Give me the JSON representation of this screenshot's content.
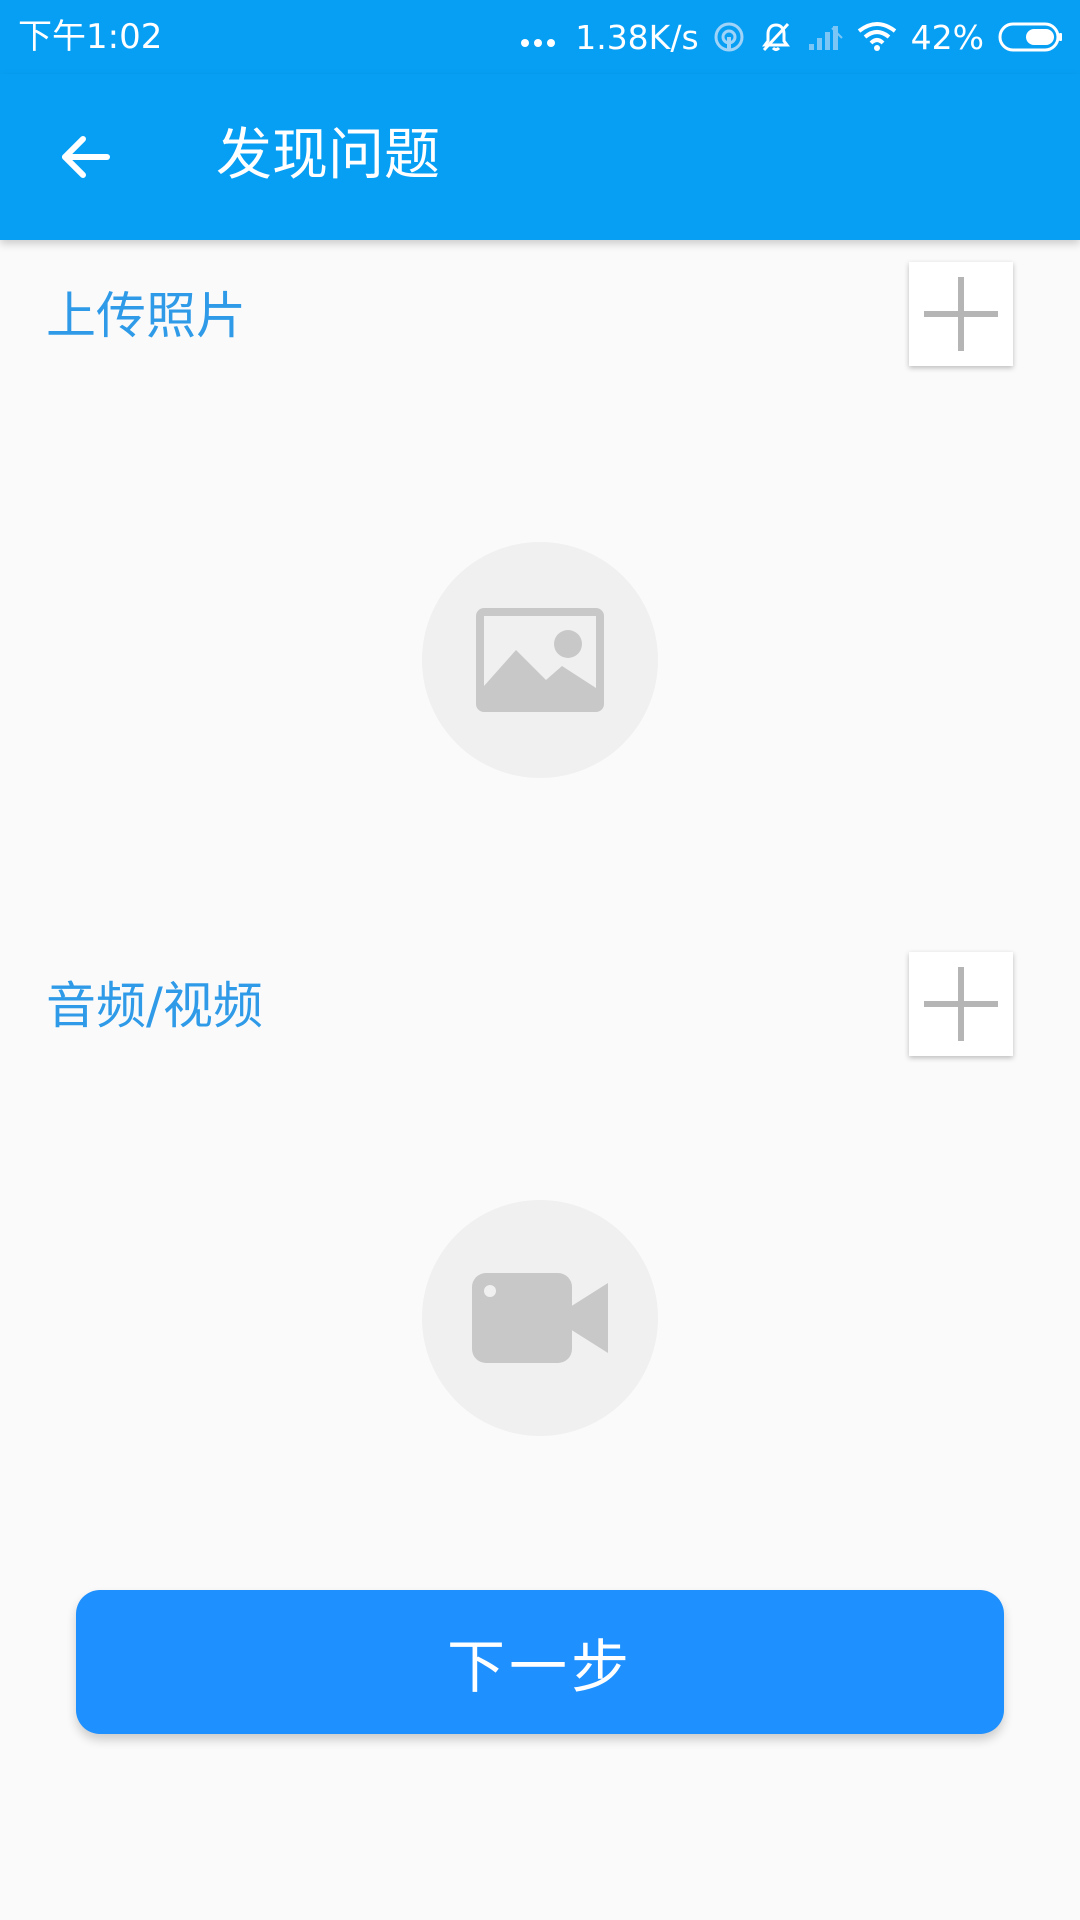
{
  "status_bar": {
    "time": "下午1:02",
    "net_speed": "1.38K/s",
    "battery": "42%",
    "icons": [
      "more-dots-icon",
      "hotspot-icon",
      "silent-bell-icon",
      "cell-signal-icon",
      "wifi-icon",
      "battery-icon"
    ]
  },
  "app_bar": {
    "title": "发现问题",
    "back_icon": "arrow-left-icon"
  },
  "photo_section": {
    "title": "上传照片",
    "add_icon": "plus-icon",
    "placeholder_icon": "image-icon"
  },
  "media_section": {
    "title": "音频/视频",
    "add_icon": "plus-icon",
    "placeholder_icon": "video-camera-icon"
  },
  "next_button": {
    "label": "下一步"
  },
  "colors": {
    "primary": "#079ff4",
    "accent_text": "#2f9be8",
    "button": "#1e90ff",
    "placeholder_bg": "#f0f0f0",
    "placeholder_icon": "#c8c8c8"
  }
}
